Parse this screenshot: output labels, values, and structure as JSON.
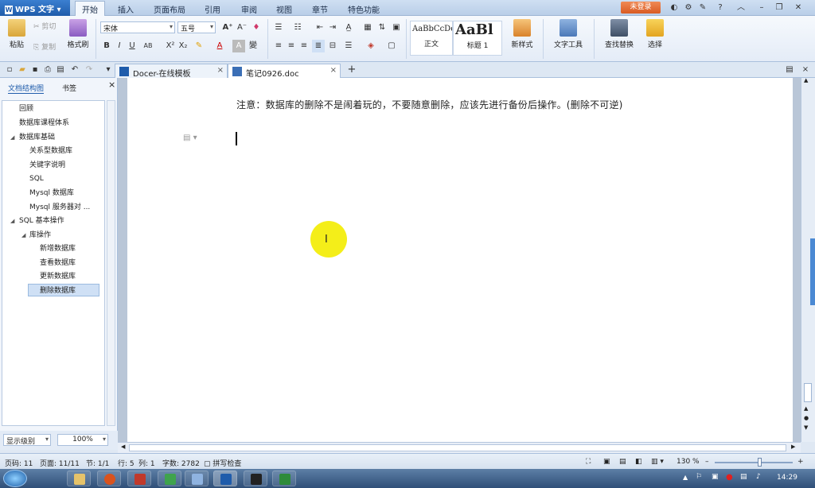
{
  "app": {
    "name": "WPS 文字",
    "logo_letter": "W"
  },
  "menu": {
    "tabs": [
      "开始",
      "插入",
      "页面布局",
      "引用",
      "审阅",
      "视图",
      "章节",
      "特色功能"
    ],
    "active": "开始",
    "login": "未登录"
  },
  "ribbon": {
    "paste": "粘贴",
    "cut": "剪切",
    "copy": "复制",
    "format_painter": "格式刷",
    "font_name": "宋体",
    "font_size": "五号",
    "style_normal_preview": "AaBbCcDd",
    "style_normal": "正文",
    "style_heading_preview": "AaBl",
    "style_heading": "标题 1",
    "new_style": "新样式",
    "text_tools": "文字工具",
    "find_replace": "查找替换",
    "select": "选择"
  },
  "tabs": [
    {
      "title": "Docer-在线模板",
      "active": false,
      "close": "×"
    },
    {
      "title": "笔记0926.doc",
      "active": true,
      "close": "×"
    }
  ],
  "new_tab": "+",
  "left_panel": {
    "tabs": [
      "文档结构图",
      "书签"
    ],
    "close": "×",
    "items": [
      {
        "label": "回顾",
        "level": 0
      },
      {
        "label": "数据库课程体系",
        "level": 0
      },
      {
        "label": "数据库基础",
        "level": 0,
        "expanded": true
      },
      {
        "label": "关系型数据库",
        "level": 1
      },
      {
        "label": "关键字说明",
        "level": 1
      },
      {
        "label": "SQL",
        "level": 1
      },
      {
        "label": "Mysql 数据库",
        "level": 1
      },
      {
        "label": "Mysql 服务器对 ...",
        "level": 1
      },
      {
        "label": "SQL 基本操作",
        "level": 0,
        "expanded": true
      },
      {
        "label": "库操作",
        "level": 1,
        "expanded": true
      },
      {
        "label": "新增数据库",
        "level": 2
      },
      {
        "label": "查看数据库",
        "level": 2
      },
      {
        "label": "更新数据库",
        "level": 2
      },
      {
        "label": "删除数据库",
        "level": 2,
        "selected": true
      }
    ],
    "level_select": "显示级别",
    "zoom_select": "100%"
  },
  "document": {
    "note_text": "注意：数据库的删除不是闹着玩的，不要随意删除，应该先进行备份后操作。(删除不可逆)"
  },
  "status": {
    "page": "页码: 11",
    "pages": "页面: 11/11",
    "section": "节: 1/1",
    "row": "行: 5",
    "col": "列: 1",
    "words": "字数: 2782",
    "spell": "拼写检查",
    "zoom": "130 %"
  },
  "taskbar": {
    "clock": "14:29"
  },
  "colors": {
    "accent": "#1f5cab",
    "login_orange": "#e06a30",
    "highlight": "#f3ec00",
    "selected_item": "#cfe0f5"
  }
}
